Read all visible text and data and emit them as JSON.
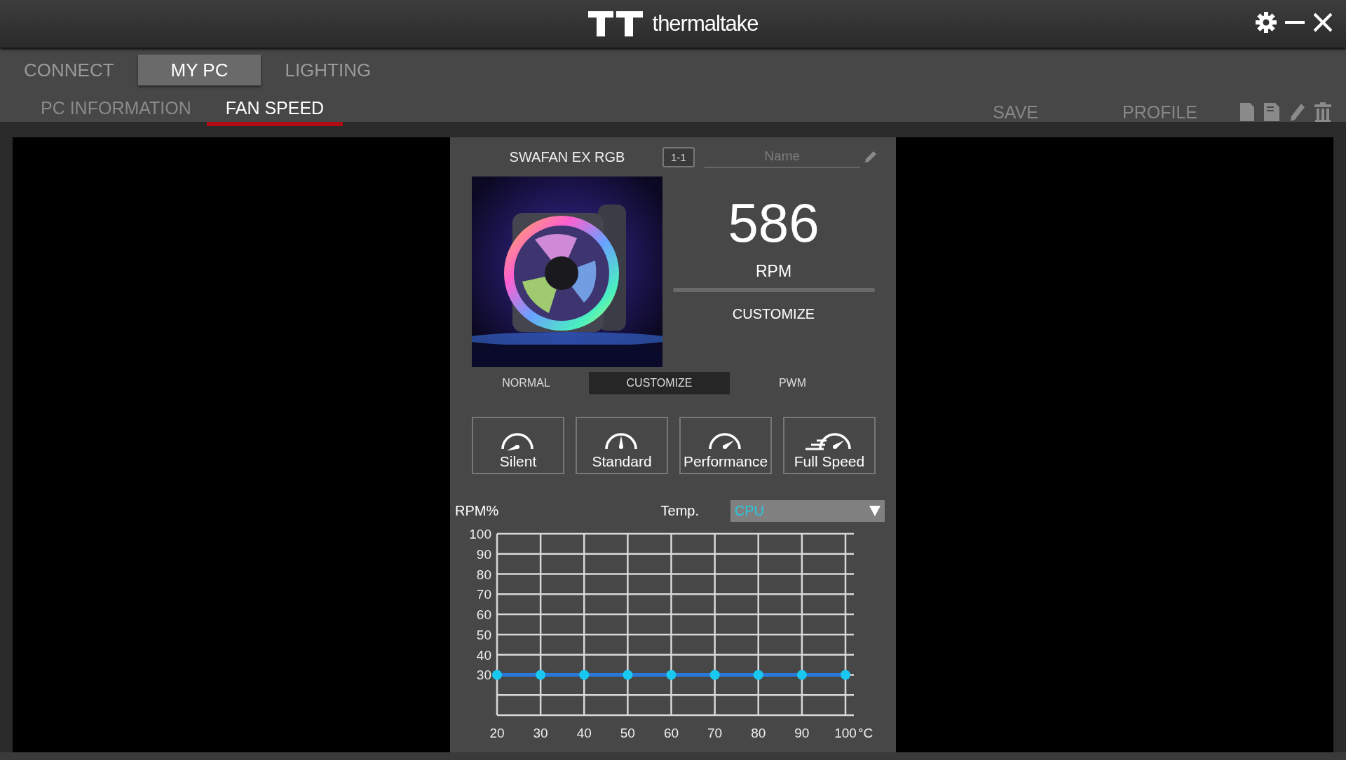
{
  "app": {
    "title": "thermaltake"
  },
  "tabs": [
    {
      "label": "CONNECT",
      "selected": false
    },
    {
      "label": "MY PC",
      "selected": true
    },
    {
      "label": "LIGHTING",
      "selected": false
    }
  ],
  "subtabs": [
    {
      "label": "PC INFORMATION",
      "selected": false
    },
    {
      "label": "FAN SPEED",
      "selected": true
    }
  ],
  "actions": [
    "SAVE",
    "PROFILE"
  ],
  "fan": {
    "model": "SWAFAN EX RGB",
    "port": "1-1",
    "name": {
      "placeholder": "Name"
    },
    "rpm": "586",
    "rpm_unit": "RPM",
    "mode": "CUSTOMIZE"
  },
  "modes": [
    {
      "label": "NORMAL",
      "selected": false
    },
    {
      "label": "CUSTOMIZE",
      "selected": true
    },
    {
      "label": "PWM",
      "selected": false
    }
  ],
  "presets": [
    {
      "label": "Silent",
      "kind": "silent"
    },
    {
      "label": "Standard",
      "kind": "standard"
    },
    {
      "label": "Performance",
      "kind": "performance"
    },
    {
      "label": "Full Speed",
      "kind": "full"
    }
  ],
  "curve": {
    "temp_label": "Temp.",
    "sensor": "CPU",
    "chart_data": {
      "type": "line",
      "grid": true,
      "xlabel": "°C",
      "x": [
        20,
        30,
        40,
        50,
        60,
        70,
        80,
        90,
        100
      ],
      "xlim": [
        20,
        100
      ],
      "ylim": [
        10,
        100
      ],
      "xticks": [
        20,
        30,
        40,
        50,
        60,
        70,
        80,
        90,
        100
      ],
      "yticks": [
        30,
        40,
        50,
        60,
        70,
        80,
        90,
        100
      ],
      "series": [
        {
          "name": "RPM%",
          "color": "#2a78d8",
          "marker": true,
          "values": [
            30,
            30,
            30,
            30,
            30,
            30,
            30,
            30,
            30
          ]
        }
      ]
    }
  }
}
